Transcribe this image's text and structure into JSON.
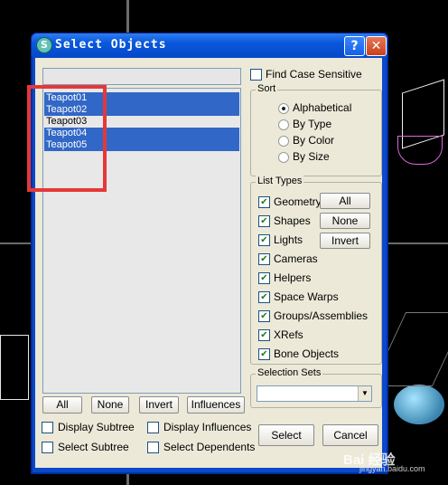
{
  "window": {
    "title": "Select Objects",
    "help_glyph": "?",
    "close_glyph": "✕",
    "app_icon_glyph": "S"
  },
  "objects": [
    {
      "name": "Teapot01",
      "selected": true
    },
    {
      "name": "Teapot02",
      "selected": true
    },
    {
      "name": "Teapot03",
      "selected": false
    },
    {
      "name": "Teapot04",
      "selected": true
    },
    {
      "name": "Teapot05",
      "selected": true
    }
  ],
  "list_buttons": {
    "all": "All",
    "none": "None",
    "invert": "Invert",
    "influences": "Influences"
  },
  "left_options": {
    "display_subtree": "Display Subtree",
    "display_influences": "Display Influences",
    "select_subtree": "Select Subtree",
    "select_dependents": "Select Dependents"
  },
  "find_case_sensitive": "Find Case Sensitive",
  "sort": {
    "label": "Sort",
    "options": [
      "Alphabetical",
      "By Type",
      "By Color",
      "By Size"
    ],
    "selected": "Alphabetical"
  },
  "list_types": {
    "label": "List Types",
    "items": [
      "Geometry",
      "Shapes",
      "Lights",
      "Cameras",
      "Helpers",
      "Space Warps",
      "Groups/Assemblies",
      "XRefs",
      "Bone Objects"
    ],
    "all": "All",
    "none": "None",
    "invert": "Invert"
  },
  "selection_sets": {
    "label": "Selection Sets",
    "value": ""
  },
  "actions": {
    "select": "Select",
    "cancel": "Cancel"
  },
  "watermark": {
    "logo": "Bai 经验",
    "url": "jingyan.baidu.com"
  },
  "colors": {
    "selection": "#3167c6",
    "highlight_box": "#e53838",
    "title_bar": "#0a58dc"
  }
}
